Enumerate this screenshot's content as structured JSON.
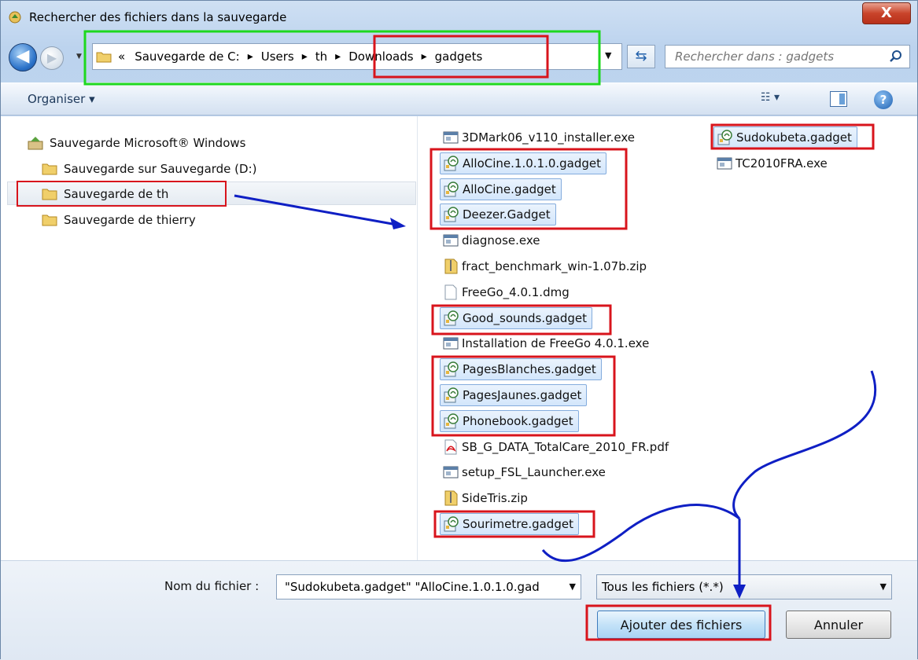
{
  "window": {
    "title": "Rechercher des fichiers dans la sauvegarde",
    "close_label": "X"
  },
  "address_bar": {
    "overflow": "«",
    "segments": [
      "Sauvegarde de C:",
      "Users",
      "th",
      "Downloads",
      "gadgets"
    ]
  },
  "search": {
    "placeholder": "Rechercher dans : gadgets"
  },
  "toolbar": {
    "organise_label": "Organiser ▾",
    "view_label": "☷ ▾",
    "help_label": "?"
  },
  "nav": {
    "items": [
      {
        "label": "Sauvegarde Microsoft® Windows",
        "icon": "backup-icon"
      },
      {
        "label": "Sauvegarde sur Sauvegarde (D:)",
        "icon": "folder-icon"
      },
      {
        "label": "Sauvegarde de th",
        "icon": "folder-icon",
        "selected": true
      },
      {
        "label": "Sauvegarde de thierry",
        "icon": "folder-icon"
      }
    ]
  },
  "files": [
    {
      "name": "3DMark06_v110_installer.exe",
      "icon": "exe-icon",
      "selected": false
    },
    {
      "name": "AlloCine.1.0.1.0.gadget",
      "icon": "gadget-icon",
      "selected": true
    },
    {
      "name": "AlloCine.gadget",
      "icon": "gadget-icon",
      "selected": true
    },
    {
      "name": "Deezer.Gadget",
      "icon": "gadget-icon",
      "selected": true
    },
    {
      "name": "diagnose.exe",
      "icon": "exe-icon",
      "selected": false
    },
    {
      "name": "fract_benchmark_win-1.07b.zip",
      "icon": "zip-icon",
      "selected": false
    },
    {
      "name": "FreeGo_4.0.1.dmg",
      "icon": "file-icon",
      "selected": false
    },
    {
      "name": "Good_sounds.gadget",
      "icon": "gadget-icon",
      "selected": true
    },
    {
      "name": "Installation de FreeGo 4.0.1.exe",
      "icon": "exe-icon",
      "selected": false
    },
    {
      "name": "PagesBlanches.gadget",
      "icon": "gadget-icon",
      "selected": true
    },
    {
      "name": "PagesJaunes.gadget",
      "icon": "gadget-icon",
      "selected": true
    },
    {
      "name": "Phonebook.gadget",
      "icon": "gadget-icon",
      "selected": true
    },
    {
      "name": "SB_G_DATA_TotalCare_2010_FR.pdf",
      "icon": "pdf-icon",
      "selected": false
    },
    {
      "name": "setup_FSL_Launcher.exe",
      "icon": "exe-icon",
      "selected": false
    },
    {
      "name": "SideTris.zip",
      "icon": "zip-icon",
      "selected": false
    },
    {
      "name": "Sourimetre.gadget",
      "icon": "gadget-icon",
      "selected": true
    },
    {
      "name": "Sudokubeta.gadget",
      "icon": "gadget-icon",
      "selected": true
    },
    {
      "name": "TC2010FRA.exe",
      "icon": "exe-icon",
      "selected": false
    }
  ],
  "footer": {
    "filename_label": "Nom du fichier :",
    "filename_value": "\"Sudokubeta.gadget\" \"AlloCine.1.0.1.0.gad",
    "filetype_value": "Tous les fichiers (*.*)",
    "add_label": "Ajouter des fichiers",
    "cancel_label": "Annuler"
  },
  "colors": {
    "annotation_red": "#d8141c",
    "annotation_green": "#1ed81e",
    "annotation_blue": "#0f1fc4",
    "selection_blue": "#d3e6fb"
  }
}
